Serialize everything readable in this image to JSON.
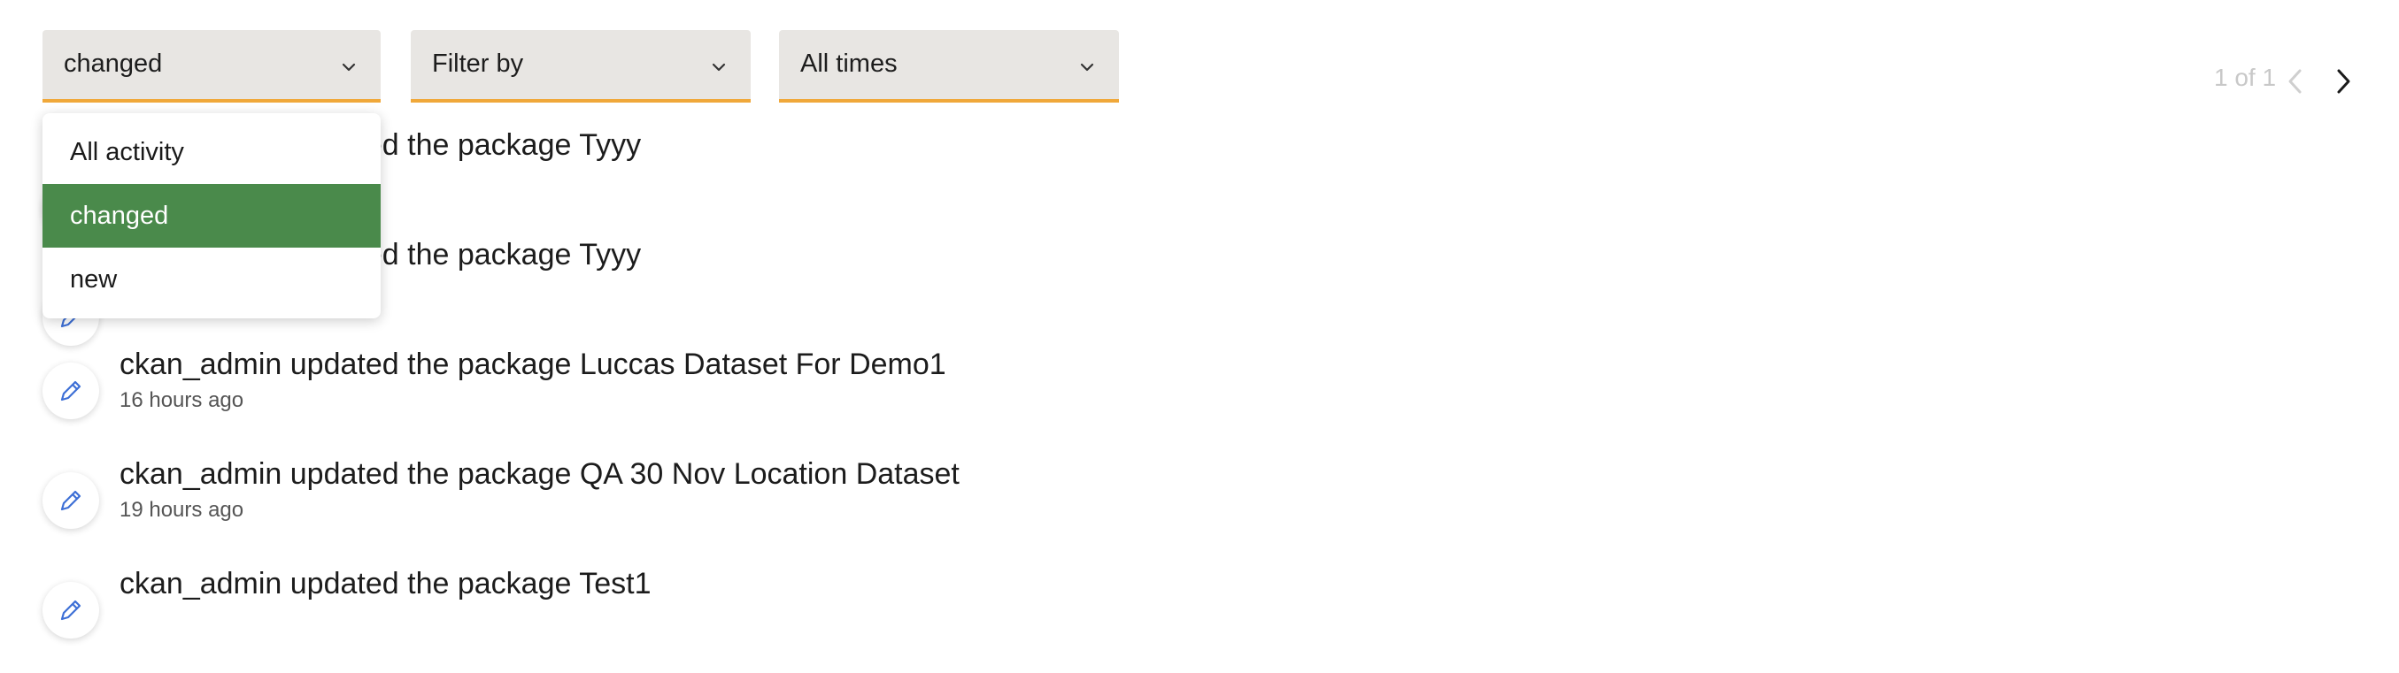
{
  "filters": {
    "activity_type": {
      "value": "changed",
      "options": [
        "All activity",
        "changed",
        "new"
      ],
      "selected_index": 1
    },
    "filter_by": {
      "value": "Filter by"
    },
    "time_range": {
      "value": "All times"
    }
  },
  "pagination": {
    "text": "1 of 1"
  },
  "activities": [
    {
      "title": "ckan_admin updated the package Tyyy",
      "time": ""
    },
    {
      "title": "ckan_admin updated the package Tyyy",
      "time": ""
    },
    {
      "title": "ckan_admin updated the package Luccas Dataset For Demo1",
      "time": "16 hours ago"
    },
    {
      "title": "ckan_admin updated the package QA 30 Nov Location Dataset",
      "time": "19 hours ago"
    },
    {
      "title": "ckan_admin updated the package Test1",
      "time": ""
    }
  ],
  "colors": {
    "select_bg": "#e8e6e3",
    "select_underline": "#f0a83a",
    "selected_option": "#4a8a4b",
    "edit_icon": "#3d6fd6"
  },
  "icons": {
    "chevron": "chevron-down-icon",
    "edit": "pencil-icon"
  }
}
